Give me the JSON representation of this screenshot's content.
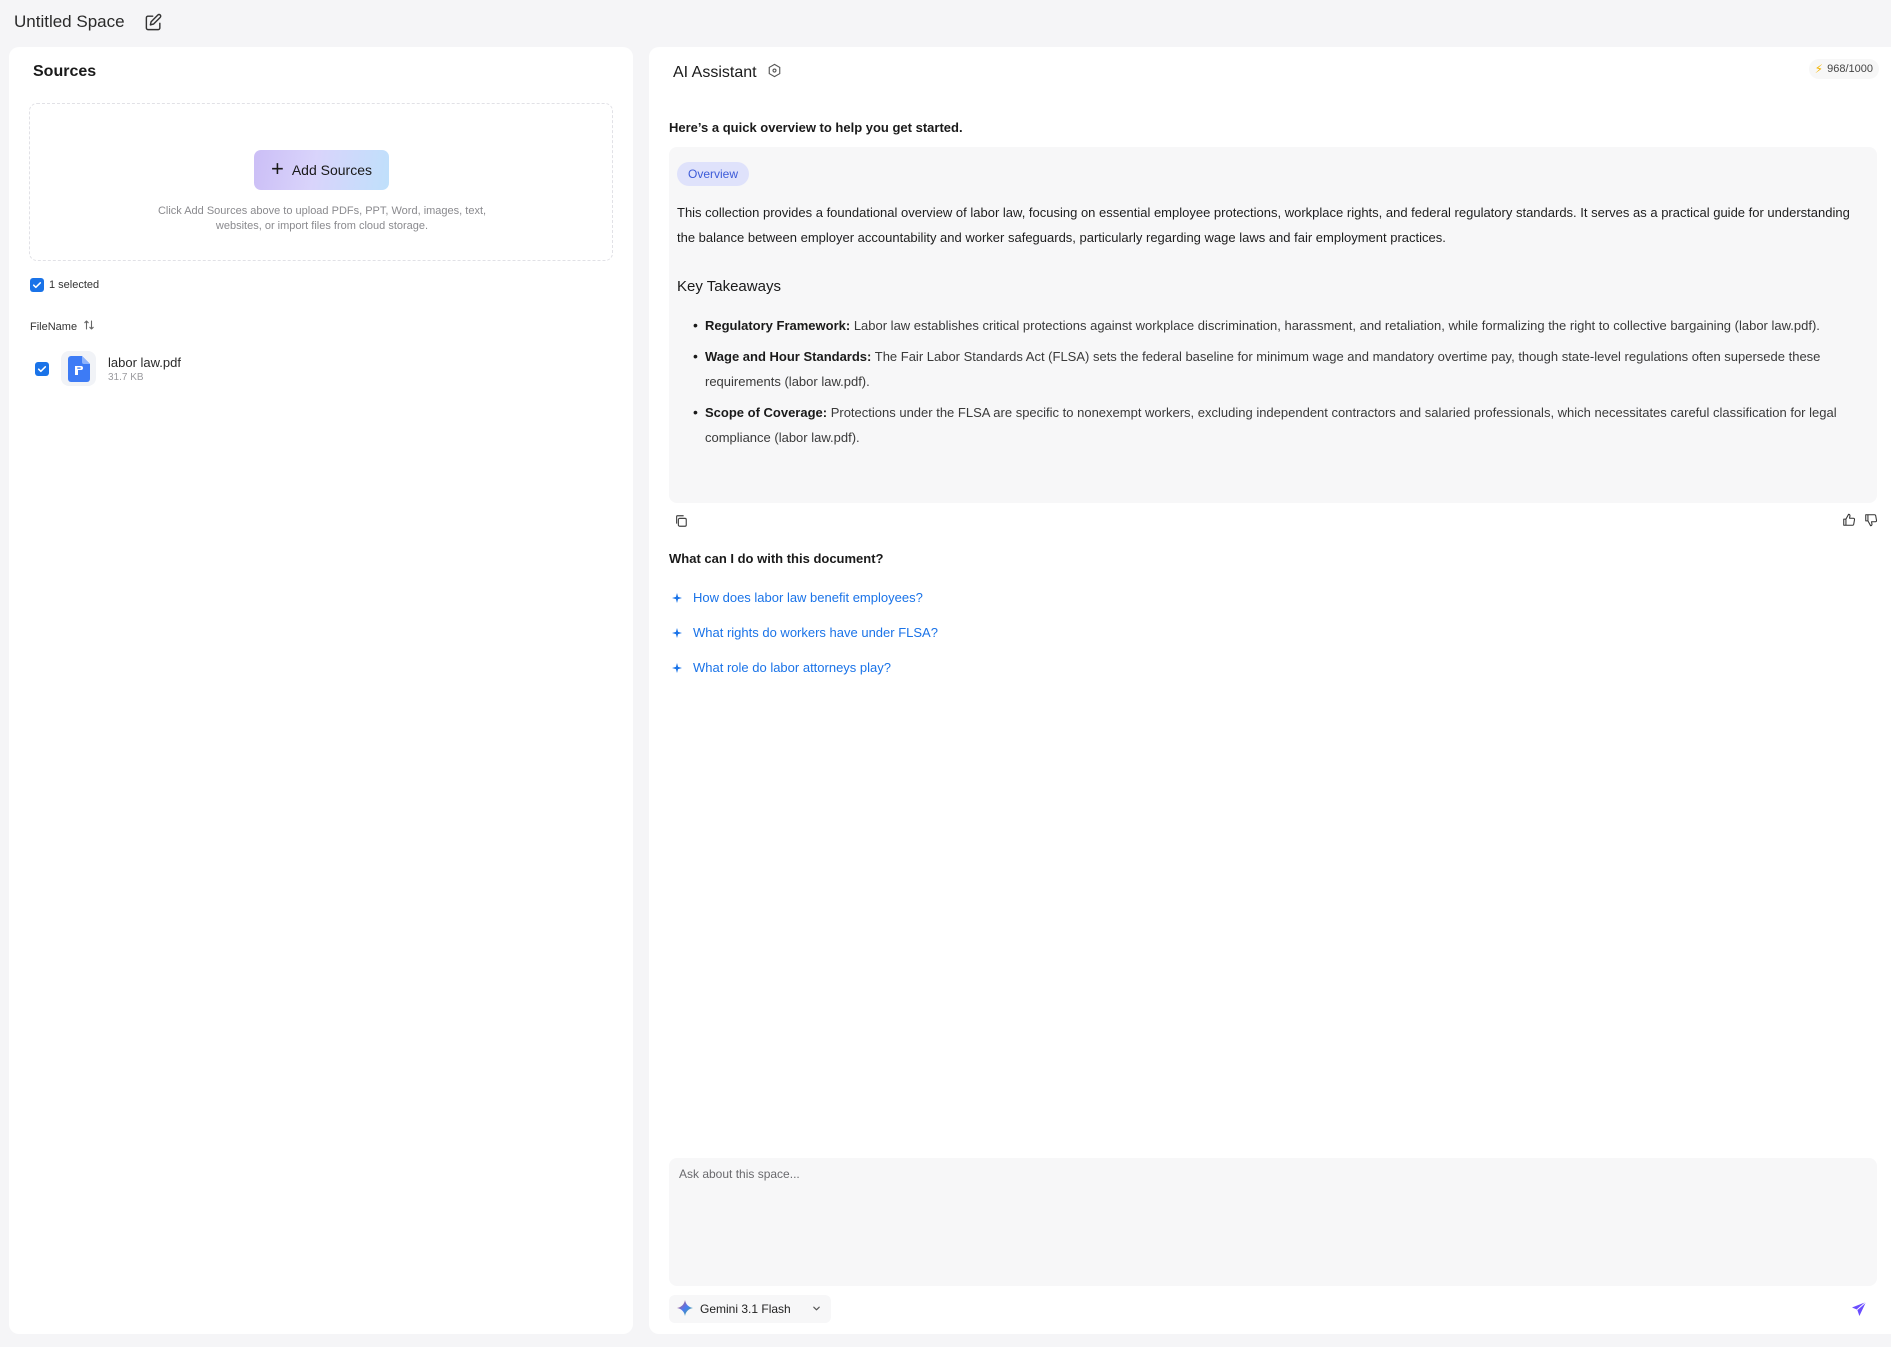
{
  "header": {
    "title": "Untitled Space",
    "edit_icon": "edit-icon"
  },
  "sources": {
    "title": "Sources",
    "add_button": "Add Sources",
    "hint": "Click Add Sources above to upload PDFs, PPT, Word, images, text, websites, or import files from cloud storage.",
    "selected_label": "1 selected",
    "column_header": "FileName",
    "files": [
      {
        "name": "labor law.pdf",
        "size": "31.7 KB",
        "checked": true
      }
    ]
  },
  "assistant": {
    "title": "AI Assistant",
    "credits": "968/1000",
    "intro": "Here’s a quick overview to help you get started.",
    "overview_badge": "Overview",
    "overview_text": "This collection provides a foundational overview of labor law, focusing on essential employee protections, workplace rights, and federal regulatory standards. It serves as a practical guide for understanding the balance between employer accountability and worker safeguards, particularly regarding wage laws and fair employment practices.",
    "takeaways_title": "Key Takeaways",
    "takeaways": [
      {
        "label": "Regulatory Framework:",
        "text": " Labor law establishes critical protections against workplace discrimination, harassment, and retaliation, while formalizing the right to collective bargaining (labor law.pdf)."
      },
      {
        "label": "Wage and Hour Standards:",
        "text": " The Fair Labor Standards Act (FLSA) sets the federal baseline for minimum wage and mandatory overtime pay, though state-level regulations often supersede these requirements (labor law.pdf)."
      },
      {
        "label": "Scope of Coverage:",
        "text": " Protections under the FLSA are specific to nonexempt workers, excluding independent contractors and salaried professionals, which necessitates careful classification for legal compliance (labor law.pdf)."
      }
    ],
    "questions_title": "What can I do with this document?",
    "questions": [
      "How does labor law benefit employees?",
      "What rights do workers have under FLSA?",
      "What role do labor attorneys play?"
    ],
    "input_placeholder": "Ask about this space...",
    "model": "Gemini 3.1 Flash"
  },
  "colors": {
    "accent": "#1a73e8",
    "badge_bg": "#dfe2fb",
    "send": "#6b4eff"
  }
}
